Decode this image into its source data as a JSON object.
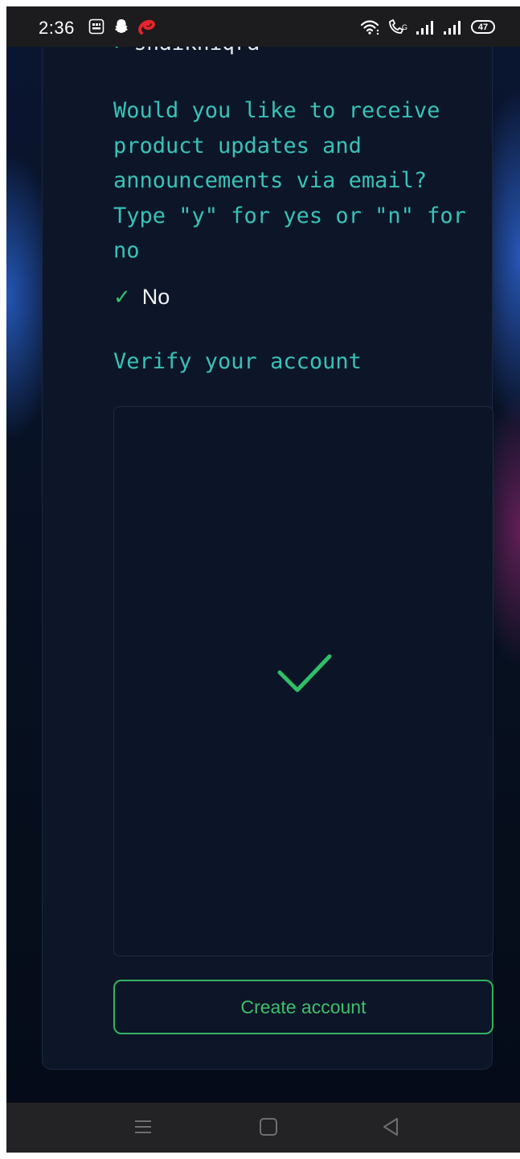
{
  "status_bar": {
    "time": "2:36",
    "battery": "47"
  },
  "form": {
    "previous_answer": "shaikhiqra",
    "question": "Would you like to receive\nproduct updates and\nannouncements via email?\nType \"y\" for yes or \"n\" for\nno",
    "answer": "No",
    "verify_heading": "Verify your account",
    "create_button_label": "Create account"
  },
  "colors": {
    "accent_teal": "#38c2b8",
    "success_green": "#33b35f",
    "card_background": "#0d1628"
  }
}
